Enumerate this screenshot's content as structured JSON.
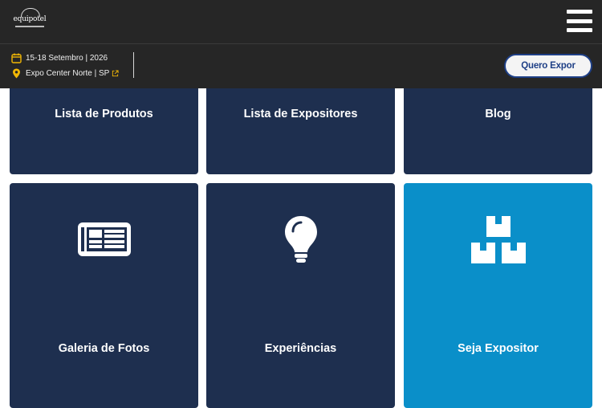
{
  "header": {
    "logo_text": "equipotel",
    "menu_icon": "hamburger-menu-icon"
  },
  "infobar": {
    "date": "15-18 Setembro | 2026",
    "location": "Expo Center Norte | SP",
    "cta_label": "Quero Expor",
    "date_icon": "calendar-icon",
    "location_icon": "map-pin-icon",
    "external_icon": "external-link-icon"
  },
  "cards": [
    {
      "label": "Lista de Produtos",
      "icon": ""
    },
    {
      "label": "Lista de Expositores",
      "icon": ""
    },
    {
      "label": "Blog",
      "icon": ""
    },
    {
      "label": "Galeria de Fotos",
      "icon": "newspaper-icon"
    },
    {
      "label": "Experiências",
      "icon": "lightbulb-icon"
    },
    {
      "label": "Seja Expositor",
      "icon": "boxes-icon"
    }
  ],
  "colors": {
    "header_bg": "#262626",
    "card_dark": "#1e2f4f",
    "card_blue": "#0a8fc9",
    "cta_border": "#1e3f86"
  }
}
